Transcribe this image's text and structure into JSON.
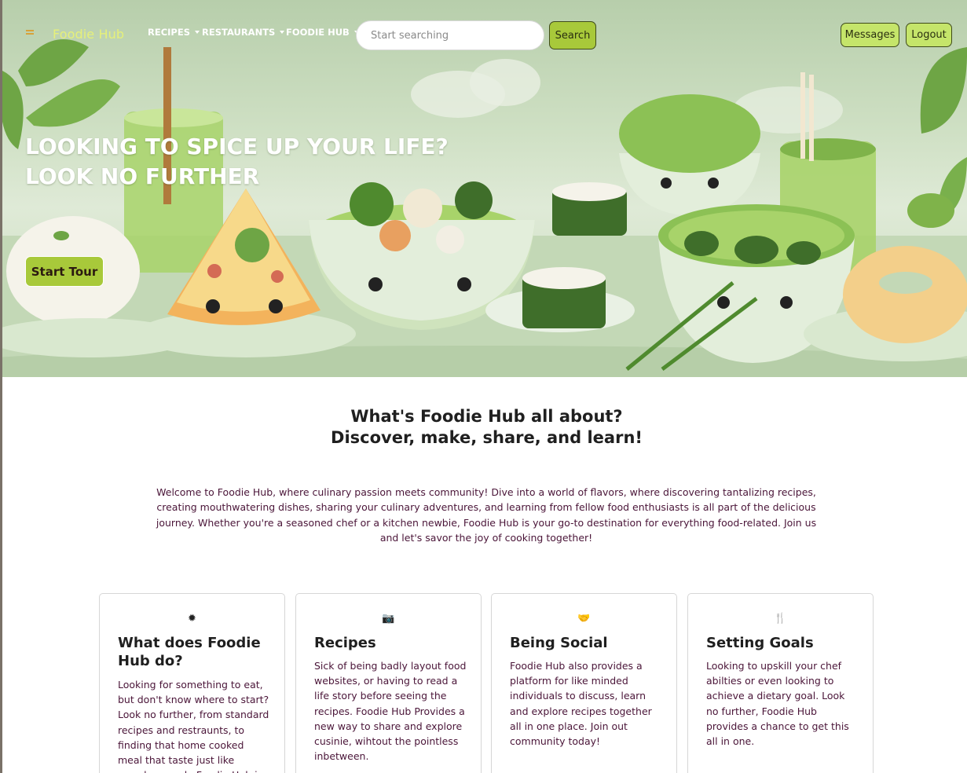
{
  "nav": {
    "brand": "Foodie Hub",
    "menu": [
      {
        "label": "RECIPES"
      },
      {
        "label": "RESTAURANTS"
      },
      {
        "label": "FOODIE HUB"
      }
    ],
    "search_placeholder": "Start searching",
    "search_button": "Search",
    "messages_button": "Messages",
    "logout_button": "Logout"
  },
  "hero": {
    "line1": "LOOKING TO SPICE UP YOUR LIFE?",
    "line2": "LOOK NO FURTHER",
    "tour_button": "Start Tour"
  },
  "about": {
    "heading_line1": "What's Foodie Hub all about?",
    "heading_line2": "Discover, make, share, and learn!",
    "text": "Welcome to Foodie Hub, where culinary passion meets community! Dive into a world of flavors, where discovering tantalizing recipes, creating mouthwatering dishes, sharing your culinary adventures, and learning from fellow food enthusiasts is all part of the delicious journey. Whether you're a seasoned chef or a kitchen newbie, Foodie Hub is your go-to destination for everything food-related. Join us and let's savor the joy of cooking together!"
  },
  "cards": [
    {
      "icon": "✹",
      "title": "What does Foodie Hub do?",
      "text": "Looking for something to eat, but don't know where to start? Look no further, from standard recipes and restraunts, to finding that home cooked meal that taste just like grandma made Foodie Hub is the place."
    },
    {
      "icon": "📷",
      "title": "Recipes",
      "text": "Sick of being badly layout food websites, or having to read a life story before seeing the recipes. Foodie Hub Provides a new way to share and explore cusinie, wihtout the pointless inbetween."
    },
    {
      "icon": "🤝",
      "title": "Being Social",
      "text": "Foodie Hub also provides a platform for like minded individuals to discuss, learn and explore recipes together all in one place. Join out community today!"
    },
    {
      "icon": "🍴",
      "title": "Setting Goals",
      "text": "Looking to upskill your chef abilties or even looking to achieve a dietary goal. Look no further, Foodie Hub provides a chance to get this all in one."
    }
  ],
  "icons": {
    "menu": "hamburger-icon",
    "card0": "sun-icon",
    "card1": "camera-icon",
    "card2": "handshake-icon",
    "card3": "utensils-icon"
  },
  "colors": {
    "accent": "#c5e56a",
    "accent_dark": "#a8c93a",
    "brand": "#e6f07a",
    "body_text": "#4a1538"
  }
}
